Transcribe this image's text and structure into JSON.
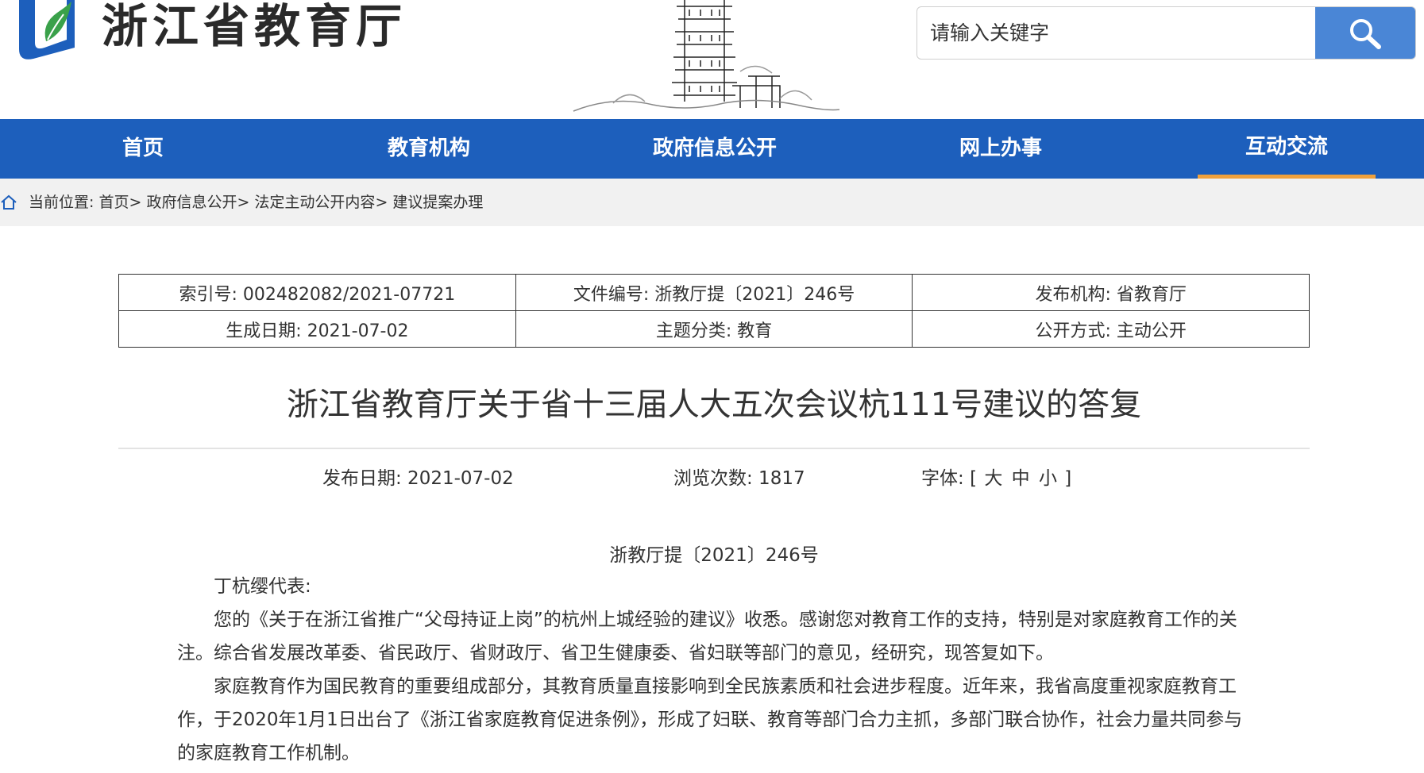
{
  "header": {
    "site_name": "浙江省教育厅",
    "search": {
      "placeholder": "请输入关键字"
    }
  },
  "nav": {
    "items": [
      {
        "label": "首页"
      },
      {
        "label": "教育机构"
      },
      {
        "label": "政府信息公开"
      },
      {
        "label": "网上办事"
      },
      {
        "label": "互动交流",
        "active": true
      }
    ],
    "accent_color": "#1d5fbc",
    "active_color": "#f0a13c"
  },
  "breadcrumb": {
    "prefix": "当前位置: ",
    "items": [
      "首页",
      "政府信息公开",
      "法定主动公开内容",
      "建议提案办理"
    ],
    "separator": "> "
  },
  "meta": {
    "rows": [
      [
        "索引号: 002482082/2021-07721",
        "文件编号: 浙教厅提〔2021〕246号",
        "发布机构: 省教育厅"
      ],
      [
        "生成日期: 2021-07-02",
        "主题分类: 教育",
        "公开方式: 主动公开"
      ]
    ]
  },
  "article": {
    "title": "浙江省教育厅关于省十三届人大五次会议杭111号建议的答复",
    "publish_date": "发布日期: 2021-07-02",
    "views": "浏览次数: 1817",
    "font_label": "字体:",
    "font_open": "[",
    "font_large": "大",
    "font_medium": "中",
    "font_small": "小",
    "font_close": "]",
    "doc_number": "浙教厅提〔2021〕246号",
    "salutation": "丁杭缨代表:",
    "paragraphs": [
      "您的《关于在浙江省推广“父母持证上岗”的杭州上城经验的建议》收悉。感谢您对教育工作的支持，特别是对家庭教育工作的关注。综合省发展改革委、省民政厅、省财政厅、省卫生健康委、省妇联等部门的意见，经研究，现答复如下。",
      "家庭教育作为国民教育的重要组成部分，其教育质量直接影响到全民族素质和社会进步程度。近年来，我省高度重视家庭教育工作，于2020年1月1日出台了《浙江省家庭教育促进条例》，形成了妇联、教育等部门合力主抓，多部门联合协作，社会力量共同参与的家庭教育工作机制。"
    ]
  }
}
